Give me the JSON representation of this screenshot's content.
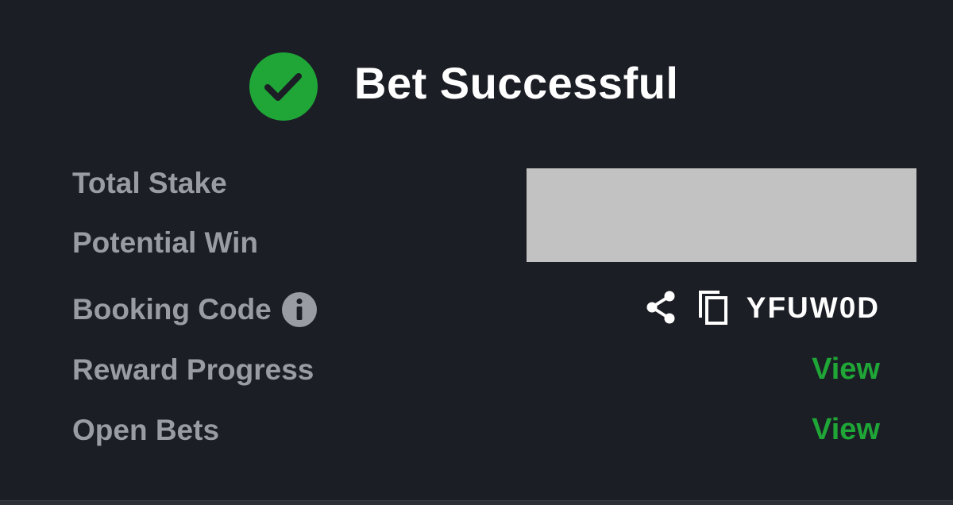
{
  "header": {
    "title": "Bet Successful",
    "icon": "check-circle-icon"
  },
  "rows": {
    "total_stake": {
      "label": "Total Stake"
    },
    "potential_win": {
      "label": "Potential Win"
    },
    "booking_code": {
      "label": "Booking Code",
      "info_icon": "info-icon",
      "share_icon": "share-icon",
      "copy_icon": "copy-icon",
      "code": "YFUW0D"
    },
    "reward_progress": {
      "label": "Reward Progress",
      "link": "View"
    },
    "open_bets": {
      "label": "Open Bets",
      "link": "View"
    }
  },
  "colors": {
    "background": "#1b1e25",
    "success_green": "#1fa637",
    "label_gray": "#9a9ca4",
    "redaction_gray": "#c2c2c2",
    "text_white": "#ffffff"
  }
}
